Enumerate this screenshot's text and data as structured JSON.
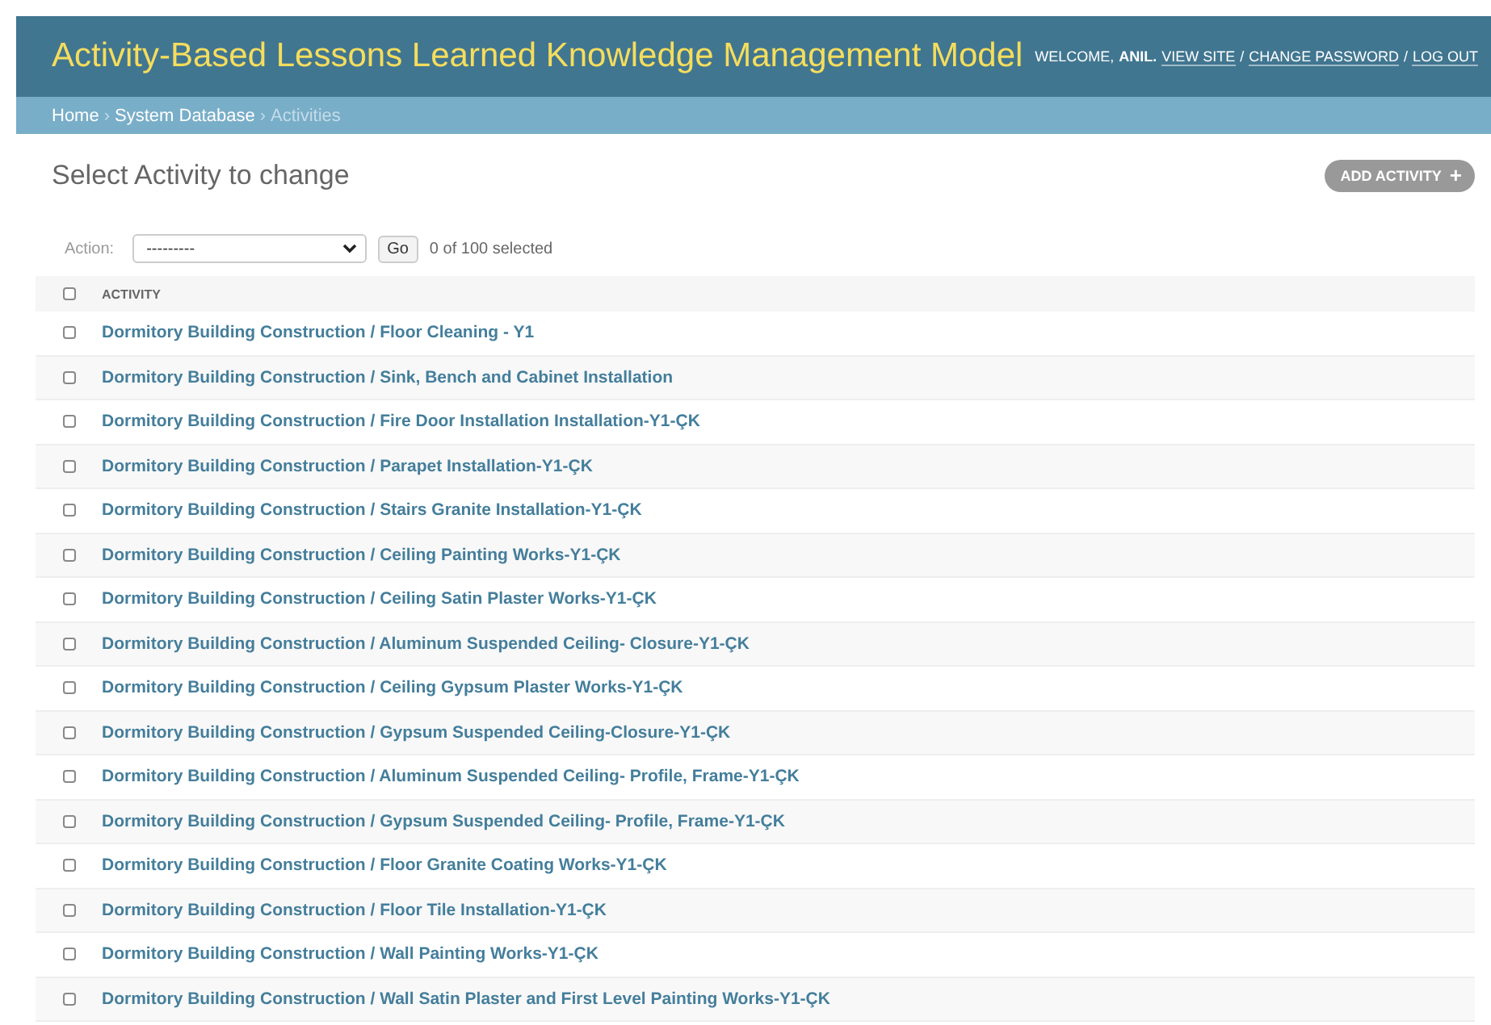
{
  "header": {
    "title": "Activity-Based Lessons Learned Knowledge Management Model",
    "welcome": "WELCOME,",
    "username": "ANIL.",
    "links": [
      "VIEW SITE",
      "CHANGE PASSWORD",
      "LOG OUT"
    ],
    "separator": "/"
  },
  "breadcrumbs": [
    {
      "label": "Home",
      "current": false
    },
    {
      "label": "System Database",
      "current": false
    },
    {
      "label": "Activities",
      "current": true
    }
  ],
  "breadcrumb_separator": "›",
  "page_title": "Select Activity to change",
  "add_button": {
    "label": "ADD ACTIVITY",
    "icon": "+"
  },
  "actions": {
    "label": "Action:",
    "value": "---------",
    "go": "Go",
    "counter": "0 of 100 selected"
  },
  "table": {
    "columns": [
      {
        "label": "ACTIVITY",
        "checked": false
      }
    ],
    "rows": [
      {
        "activity": "Dormitory Building Construction / Floor Cleaning - Y1",
        "checked": false
      },
      {
        "activity": "Dormitory Building Construction / Sink, Bench and Cabinet Installation",
        "checked": false
      },
      {
        "activity": "Dormitory Building Construction / Fire Door Installation Installation-Y1-ÇK",
        "checked": false
      },
      {
        "activity": "Dormitory Building Construction / Parapet Installation-Y1-ÇK",
        "checked": false
      },
      {
        "activity": "Dormitory Building Construction / Stairs Granite Installation-Y1-ÇK",
        "checked": false
      },
      {
        "activity": "Dormitory Building Construction / Ceiling Painting Works-Y1-ÇK",
        "checked": false
      },
      {
        "activity": "Dormitory Building Construction / Ceiling Satin Plaster Works-Y1-ÇK",
        "checked": false
      },
      {
        "activity": "Dormitory Building Construction / Aluminum Suspended Ceiling- Closure-Y1-ÇK",
        "checked": false
      },
      {
        "activity": "Dormitory Building Construction / Ceiling Gypsum Plaster Works-Y1-ÇK",
        "checked": false
      },
      {
        "activity": "Dormitory Building Construction / Gypsum Suspended Ceiling-Closure-Y1-ÇK",
        "checked": false
      },
      {
        "activity": "Dormitory Building Construction / Aluminum Suspended Ceiling- Profile, Frame-Y1-ÇK",
        "checked": false
      },
      {
        "activity": "Dormitory Building Construction / Gypsum Suspended Ceiling- Profile, Frame-Y1-ÇK",
        "checked": false
      },
      {
        "activity": "Dormitory Building Construction / Floor Granite Coating Works-Y1-ÇK",
        "checked": false
      },
      {
        "activity": "Dormitory Building Construction / Floor Tile Installation-Y1-ÇK",
        "checked": false
      },
      {
        "activity": "Dormitory Building Construction / Wall Painting Works-Y1-ÇK",
        "checked": false
      },
      {
        "activity": "Dormitory Building Construction / Wall Satin Plaster and First Level Painting Works-Y1-ÇK",
        "checked": false
      }
    ]
  }
}
